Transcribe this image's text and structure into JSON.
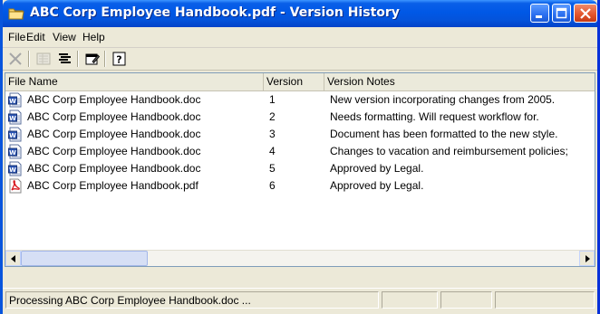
{
  "window": {
    "title": "ABC Corp Employee Handbook.pdf - Version History",
    "title_icon": "folder-icon"
  },
  "menu": {
    "file": "File",
    "edit": "Edit",
    "view": "View",
    "help": "Help"
  },
  "toolbar": {
    "icons": [
      "delete-icon",
      "list-view-icon",
      "details-view-icon",
      "properties-icon",
      "help-icon"
    ]
  },
  "list": {
    "columns": [
      "File Name",
      "Version",
      "Version Notes"
    ],
    "rows": [
      {
        "name": "ABC Corp Employee Handbook.doc",
        "icon": "word-doc-icon",
        "version": "1",
        "notes": "New version incorporating changes from 2005."
      },
      {
        "name": "ABC Corp Employee Handbook.doc",
        "icon": "word-doc-icon",
        "version": "2",
        "notes": "Needs formatting. Will request workflow for."
      },
      {
        "name": "ABC Corp Employee Handbook.doc",
        "icon": "word-doc-icon",
        "version": "3",
        "notes": "Document has been formatted to the new style."
      },
      {
        "name": "ABC Corp Employee Handbook.doc",
        "icon": "word-doc-icon",
        "version": "4",
        "notes": "Changes to vacation and reimbursement policies;"
      },
      {
        "name": "ABC Corp Employee Handbook.doc",
        "icon": "word-doc-icon",
        "version": "5",
        "notes": "Approved by Legal."
      },
      {
        "name": "ABC Corp Employee Handbook.pdf",
        "icon": "pdf-icon",
        "version": "6",
        "notes": "Approved by Legal."
      }
    ]
  },
  "status": {
    "text": "Processing ABC Corp Employee Handbook.doc ..."
  },
  "colors": {
    "titlebar": "#0058e6",
    "window_border": "#0831d9",
    "face": "#ece9d8"
  }
}
